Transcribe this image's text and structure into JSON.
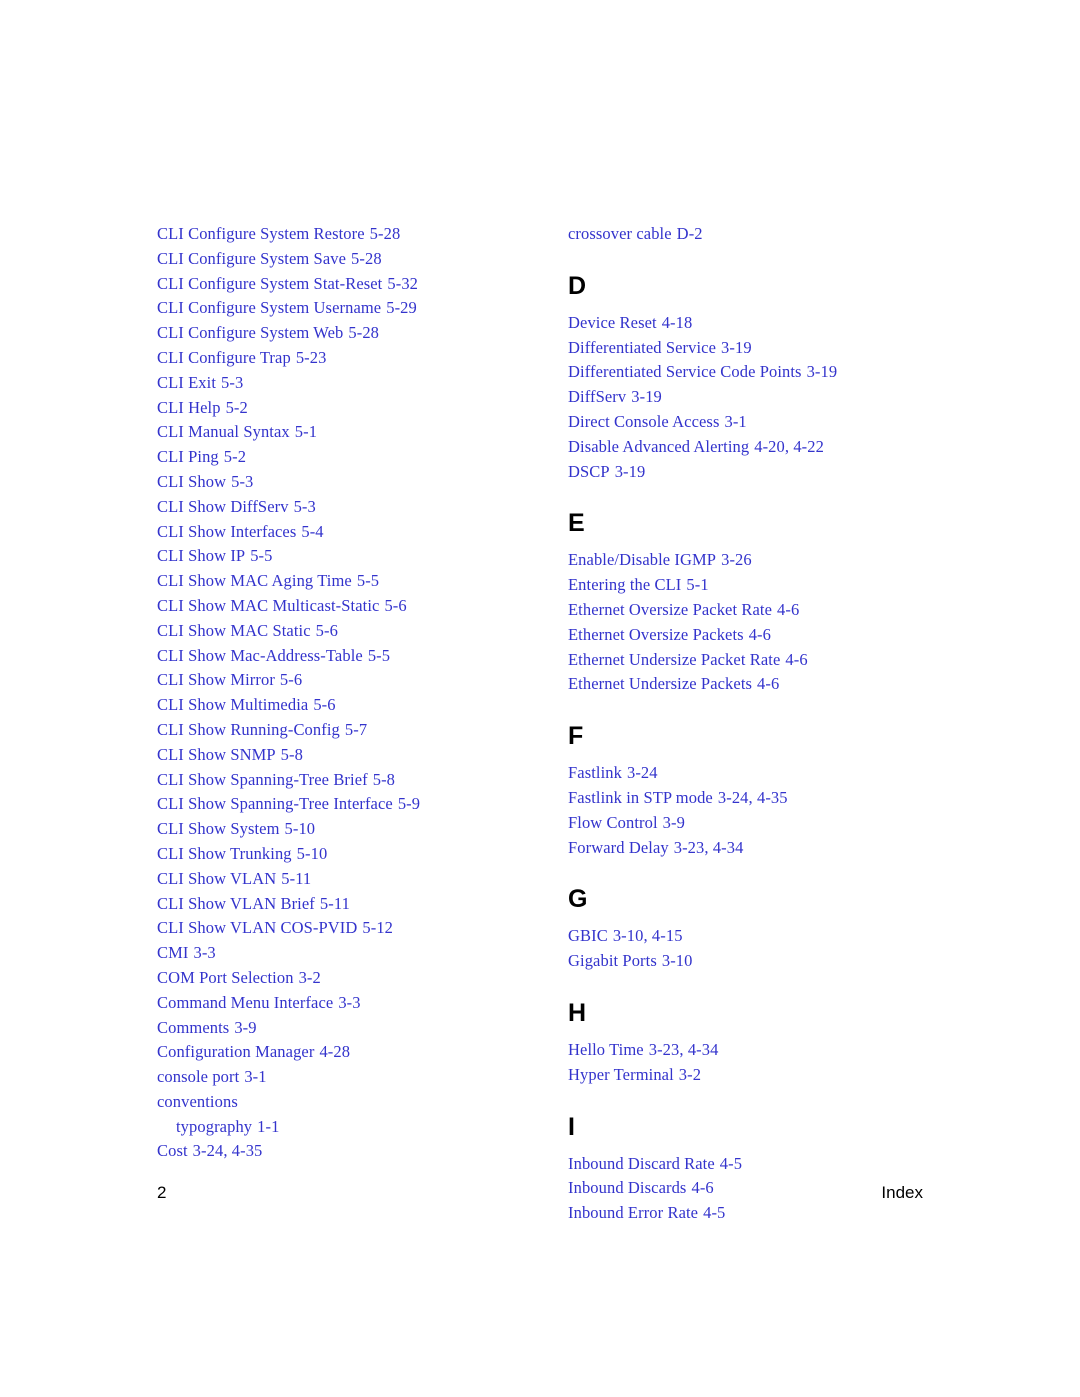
{
  "document": {
    "type": "index",
    "footer": {
      "page_number": "2",
      "label": "Index"
    },
    "colors": {
      "entry_text": "#3333cc",
      "heading_text": "#000000",
      "background": "#ffffff"
    }
  },
  "left_column": {
    "sections": [
      {
        "letter": "",
        "entries": [
          {
            "term": "CLI Configure System Restore",
            "pages": "5-28",
            "sub": false
          },
          {
            "term": "CLI Configure System Save",
            "pages": "5-28",
            "sub": false
          },
          {
            "term": "CLI Configure System Stat-Reset",
            "pages": "5-32",
            "sub": false
          },
          {
            "term": "CLI Configure System Username",
            "pages": "5-29",
            "sub": false
          },
          {
            "term": "CLI Configure System Web",
            "pages": "5-28",
            "sub": false
          },
          {
            "term": "CLI Configure Trap",
            "pages": "5-23",
            "sub": false
          },
          {
            "term": "CLI Exit",
            "pages": "5-3",
            "sub": false
          },
          {
            "term": "CLI Help",
            "pages": "5-2",
            "sub": false
          },
          {
            "term": "CLI Manual Syntax",
            "pages": "5-1",
            "sub": false
          },
          {
            "term": "CLI Ping",
            "pages": "5-2",
            "sub": false
          },
          {
            "term": "CLI Show",
            "pages": "5-3",
            "sub": false
          },
          {
            "term": "CLI Show DiffServ",
            "pages": "5-3",
            "sub": false
          },
          {
            "term": "CLI Show Interfaces",
            "pages": "5-4",
            "sub": false
          },
          {
            "term": "CLI Show IP",
            "pages": "5-5",
            "sub": false
          },
          {
            "term": "CLI Show MAC Aging Time",
            "pages": "5-5",
            "sub": false
          },
          {
            "term": "CLI Show MAC Multicast-Static",
            "pages": "5-6",
            "sub": false
          },
          {
            "term": "CLI Show MAC Static",
            "pages": "5-6",
            "sub": false
          },
          {
            "term": "CLI Show Mac-Address-Table",
            "pages": "5-5",
            "sub": false
          },
          {
            "term": "CLI Show Mirror",
            "pages": "5-6",
            "sub": false
          },
          {
            "term": "CLI Show Multimedia",
            "pages": "5-6",
            "sub": false
          },
          {
            "term": "CLI Show Running-Config",
            "pages": "5-7",
            "sub": false
          },
          {
            "term": "CLI Show SNMP",
            "pages": "5-8",
            "sub": false
          },
          {
            "term": "CLI Show Spanning-Tree Brief",
            "pages": "5-8",
            "sub": false
          },
          {
            "term": "CLI Show Spanning-Tree Interface",
            "pages": "5-9",
            "sub": false
          },
          {
            "term": "CLI Show System",
            "pages": "5-10",
            "sub": false
          },
          {
            "term": "CLI Show Trunking",
            "pages": "5-10",
            "sub": false
          },
          {
            "term": "CLI Show VLAN",
            "pages": "5-11",
            "sub": false
          },
          {
            "term": "CLI Show VLAN Brief",
            "pages": "5-11",
            "sub": false
          },
          {
            "term": "CLI Show VLAN COS-PVID",
            "pages": "5-12",
            "sub": false
          },
          {
            "term": "CMI",
            "pages": "3-3",
            "sub": false
          },
          {
            "term": "COM Port Selection",
            "pages": "3-2",
            "sub": false
          },
          {
            "term": "Command Menu Interface",
            "pages": "3-3",
            "sub": false
          },
          {
            "term": "Comments",
            "pages": "3-9",
            "sub": false
          },
          {
            "term": "Configuration Manager",
            "pages": "4-28",
            "sub": false
          },
          {
            "term": "console port",
            "pages": "3-1",
            "sub": false
          },
          {
            "term": "conventions",
            "pages": "",
            "sub": false
          },
          {
            "term": "typography",
            "pages": "1-1",
            "sub": true
          },
          {
            "term": "Cost",
            "pages": "3-24, 4-35",
            "sub": false
          }
        ]
      }
    ]
  },
  "right_column": {
    "sections": [
      {
        "letter": "",
        "entries": [
          {
            "term": "crossover cable",
            "pages": "D-2",
            "sub": false
          }
        ]
      },
      {
        "letter": "D",
        "entries": [
          {
            "term": "Device Reset",
            "pages": "4-18",
            "sub": false
          },
          {
            "term": "Differentiated Service",
            "pages": "3-19",
            "sub": false
          },
          {
            "term": "Differentiated Service Code Points",
            "pages": "3-19",
            "sub": false
          },
          {
            "term": "DiffServ",
            "pages": "3-19",
            "sub": false
          },
          {
            "term": "Direct Console Access",
            "pages": "3-1",
            "sub": false
          },
          {
            "term": "Disable Advanced Alerting",
            "pages": "4-20, 4-22",
            "sub": false
          },
          {
            "term": "DSCP",
            "pages": "3-19",
            "sub": false
          }
        ]
      },
      {
        "letter": "E",
        "entries": [
          {
            "term": "Enable/Disable IGMP",
            "pages": "3-26",
            "sub": false
          },
          {
            "term": "Entering the CLI",
            "pages": "5-1",
            "sub": false
          },
          {
            "term": "Ethernet Oversize Packet Rate",
            "pages": "4-6",
            "sub": false
          },
          {
            "term": "Ethernet Oversize Packets",
            "pages": "4-6",
            "sub": false
          },
          {
            "term": "Ethernet Undersize Packet Rate",
            "pages": "4-6",
            "sub": false
          },
          {
            "term": "Ethernet Undersize Packets",
            "pages": "4-6",
            "sub": false
          }
        ]
      },
      {
        "letter": "F",
        "entries": [
          {
            "term": "Fastlink",
            "pages": "3-24",
            "sub": false
          },
          {
            "term": "Fastlink in STP mode",
            "pages": "3-24, 4-35",
            "sub": false
          },
          {
            "term": "Flow Control",
            "pages": "3-9",
            "sub": false
          },
          {
            "term": "Forward Delay",
            "pages": "3-23, 4-34",
            "sub": false
          }
        ]
      },
      {
        "letter": "G",
        "entries": [
          {
            "term": "GBIC",
            "pages": "3-10, 4-15",
            "sub": false
          },
          {
            "term": "Gigabit Ports",
            "pages": "3-10",
            "sub": false
          }
        ]
      },
      {
        "letter": "H",
        "entries": [
          {
            "term": "Hello Time",
            "pages": "3-23, 4-34",
            "sub": false
          },
          {
            "term": "Hyper Terminal",
            "pages": "3-2",
            "sub": false
          }
        ]
      },
      {
        "letter": "I",
        "entries": [
          {
            "term": "Inbound Discard Rate",
            "pages": "4-5",
            "sub": false
          },
          {
            "term": "Inbound Discards",
            "pages": "4-6",
            "sub": false
          },
          {
            "term": "Inbound Error Rate",
            "pages": "4-5",
            "sub": false
          }
        ]
      }
    ]
  }
}
